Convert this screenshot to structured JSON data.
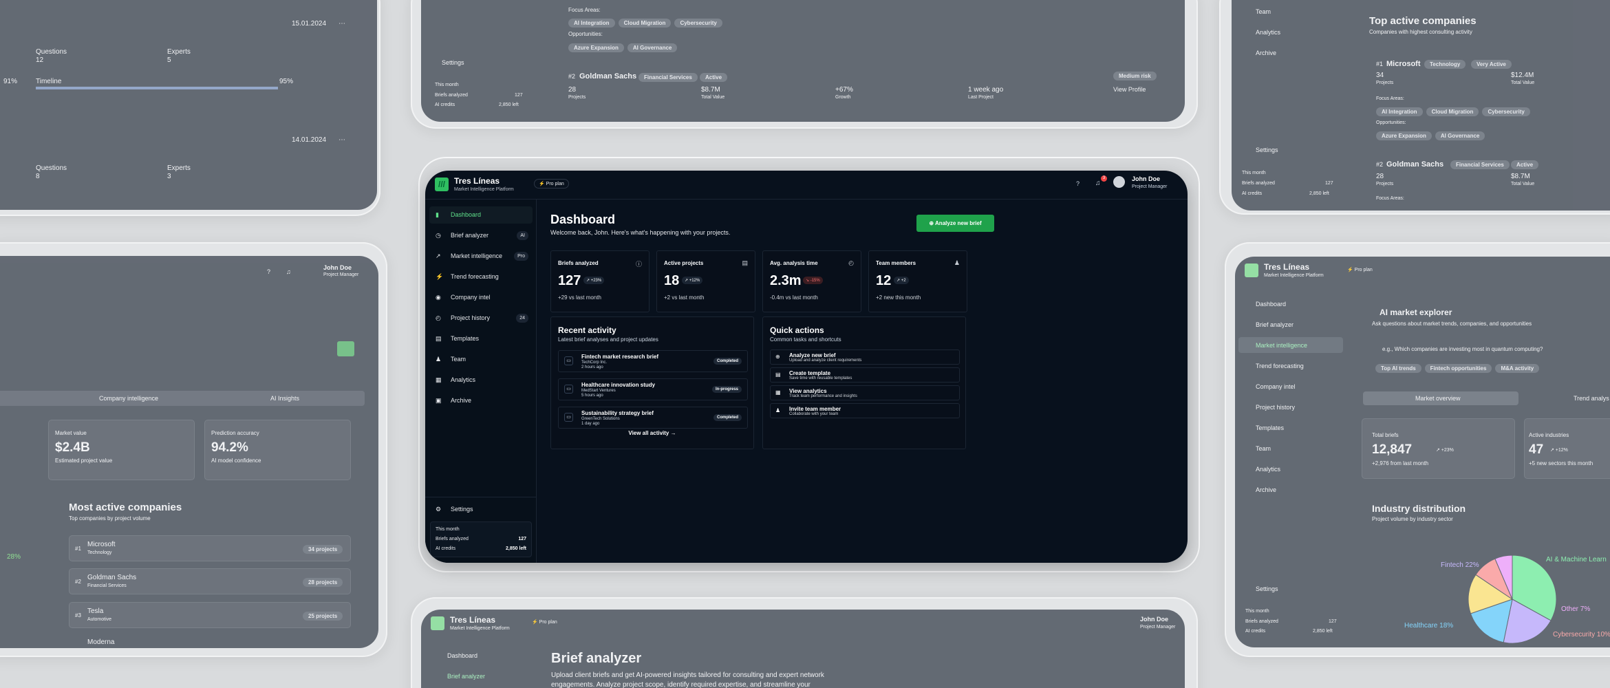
{
  "app": {
    "brand": "Tres Líneas",
    "brand_sub": "Market Intelligence Platform",
    "plan": "⚡ Pro plan",
    "user": "John Doe",
    "role": "Project Manager",
    "notifications": "3"
  },
  "nav": [
    {
      "label": "Dashboard",
      "icon": "bar-chart-icon",
      "badge": ""
    },
    {
      "label": "Brief analyzer",
      "icon": "compass-icon",
      "badge": "AI"
    },
    {
      "label": "Market intelligence",
      "icon": "trend-icon",
      "badge": "Pro"
    },
    {
      "label": "Trend forecasting",
      "icon": "lightning-icon",
      "badge": ""
    },
    {
      "label": "Company intel",
      "icon": "database-icon",
      "badge": ""
    },
    {
      "label": "Project history",
      "icon": "clock-icon",
      "badge": "24"
    },
    {
      "label": "Templates",
      "icon": "document-icon",
      "badge": ""
    },
    {
      "label": "Team",
      "icon": "users-icon",
      "badge": ""
    },
    {
      "label": "Analytics",
      "icon": "chart-icon",
      "badge": ""
    },
    {
      "label": "Archive",
      "icon": "archive-icon",
      "badge": ""
    }
  ],
  "settings": "Settings",
  "usage": {
    "title": "This month",
    "briefs_label": "Briefs analyzed",
    "briefs": "127",
    "credits_label": "AI credits",
    "credits": "2,850 left"
  },
  "dashboard": {
    "title": "Dashboard",
    "subtitle": "Welcome back, John. Here's what's happening with your projects.",
    "primary_action": "Analyze new brief"
  },
  "stats": [
    {
      "label": "Briefs analyzed",
      "value": "127",
      "change": "↗ +23%",
      "sub": "+29 vs last month",
      "icon": "info-icon"
    },
    {
      "label": "Active projects",
      "value": "18",
      "change": "↗ +12%",
      "sub": "+2 vs last month",
      "icon": "document-icon"
    },
    {
      "label": "Avg. analysis time",
      "value": "2.3m",
      "change": "↘ -15%",
      "sub": "-0.4m vs last month",
      "icon": "clock-icon"
    },
    {
      "label": "Team members",
      "value": "12",
      "change": "↗ +2",
      "sub": "+2 new this month",
      "icon": "users-icon"
    }
  ],
  "recent": {
    "title": "Recent activity",
    "subtitle": "Latest brief analyses and project updates",
    "link": "View all activity",
    "items": [
      {
        "title": "Fintech market research brief",
        "company": "TechCorp Inc.",
        "time": "2 hours ago",
        "status": "Completed"
      },
      {
        "title": "Healthcare innovation study",
        "company": "MedStart Ventures",
        "time": "5 hours ago",
        "status": "In-progress"
      },
      {
        "title": "Sustainability strategy brief",
        "company": "GreenTech Solutions",
        "time": "1 day ago",
        "status": "Completed"
      }
    ]
  },
  "quick": {
    "title": "Quick actions",
    "subtitle": "Common tasks and shortcuts",
    "items": [
      {
        "title": "Analyze new brief",
        "sub": "Upload and analyze client requirements",
        "icon": "plus-icon"
      },
      {
        "title": "Create template",
        "sub": "Save time with reusable templates",
        "icon": "document-icon"
      },
      {
        "title": "View analytics",
        "sub": "Track team performance and insights",
        "icon": "chart-icon"
      },
      {
        "title": "Invite team member",
        "sub": "Collaborate with your team",
        "icon": "users-icon"
      }
    ]
  },
  "bg": {
    "date1": "15.01.2024",
    "date2": "14.01.2024",
    "questions": "Questions",
    "experts": "Experts",
    "q1": "12",
    "e1": "5",
    "q2": "8",
    "e2": "3",
    "timeline": "Timeline",
    "p91": "91%",
    "p95": "95%",
    "focus": "Focus Areas:",
    "opps": "Opportunities:",
    "ai_integration": "AI Integration",
    "cloud": "Cloud Migration",
    "cyber": "Cybersecurity",
    "azure": "Azure Expansion",
    "ai_gov": "AI Governance",
    "goldman": "Goldman Sachs",
    "fin_services": "Financial Services",
    "active": "Active",
    "medium_risk": "Medium risk",
    "projects": "Projects",
    "total_value": "Total Value",
    "growth": "Growth",
    "last_project": "Last Project",
    "view_profile": "View Profile",
    "v28": "28",
    "v87": "$8.7M",
    "v67": "+67%",
    "one_week": "1 week ago",
    "top_active": "Top active companies",
    "top_active_sub": "Companies with highest consulting activity",
    "microsoft": "Microsoft",
    "technology": "Technology",
    "very_active": "Very Active",
    "v34": "34",
    "v124": "$12.4M",
    "company_intel": "Company intelligence",
    "ai_insights": "AI Insights",
    "market_value": "Market value",
    "mv": "$2.4B",
    "mv_sub": "Estimated project value",
    "pred": "Prediction accuracy",
    "pred_v": "94.2%",
    "pred_sub": "AI model confidence",
    "most_active": "Most active companies",
    "most_active_sub": "Top companies by project volume",
    "tesla": "Tesla",
    "automotive": "Automotive",
    "p34": "34 projects",
    "p28": "28 projects",
    "p25": "25 projects",
    "moderna": "Moderna",
    "p28pct": "28%",
    "explorer": "AI market explorer",
    "explorer_sub": "Ask questions about market trends, companies, and opportunities",
    "explorer_ph": "e.g., Which companies are investing most in quantum computing?",
    "t1": "Top AI trends",
    "t2": "Fintech opportunities",
    "t3": "M&A activity",
    "overview": "Market overview",
    "trend_analysis": "Trend analys",
    "total_briefs": "Total briefs",
    "tb": "12,847",
    "tb_sub": "+2,976 from last month",
    "tb_chg": "↗ +23%",
    "active_ind": "Active industries",
    "ai_v": "47",
    "ai_chg": "↗ +12%",
    "ai_sub": "+5 new sectors this month",
    "industry": "Industry distribution",
    "industry_sub": "Project volume by industry sector",
    "fintech": "Fintech 22%",
    "aiml": "AI & Machine Learn",
    "other": "Other 7%",
    "healthcare": "Healthcare 18%",
    "cyber10": "Cybersecurity 10%",
    "brief": "Brief analyzer",
    "brief_sub": "Upload client briefs and get AI-powered insights tailored for consulting and expert network",
    "brief_sub2": "engagements. Analyze project scope, identify required expertise, and streamline your"
  },
  "chart_data": {
    "type": "pie",
    "categories": [
      "AI & Machine Learn",
      "Fintech",
      "Healthcare",
      "Cybersecurity",
      "Other"
    ],
    "values": [
      36,
      22,
      18,
      10,
      7
    ]
  }
}
